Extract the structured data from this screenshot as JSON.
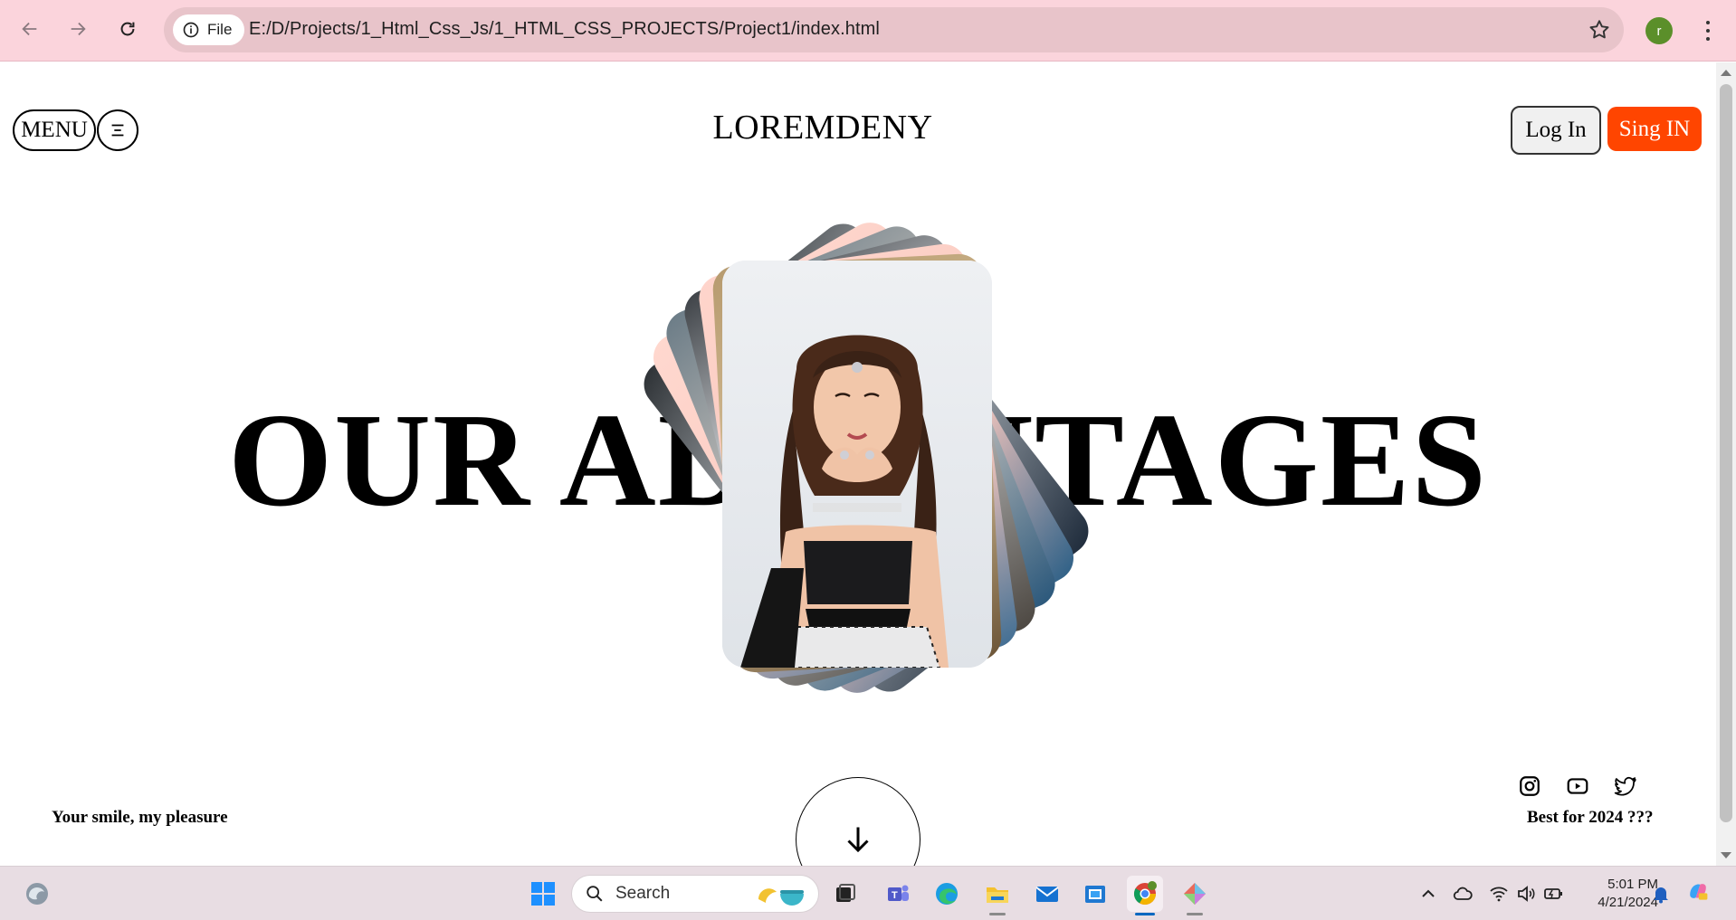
{
  "browser": {
    "site_label": "File",
    "url": "E:/D/Projects/1_Html_Css_Js/1_HTML_CSS_PROJECTS/Project1/index.html",
    "profile_initial": "r"
  },
  "page": {
    "menu_label": "MENU",
    "logo": "LOREMDENY",
    "login_label": "Log In",
    "signin_label": "Sing IN",
    "hero_title": "OUR ADVANTAGES",
    "tagline": "Your smile, my pleasure",
    "best_for": "Best for 2024 ???",
    "accent_color": "#ff4500",
    "social_icons": [
      "instagram-icon",
      "youtube-icon",
      "twitter-icon"
    ]
  },
  "taskbar": {
    "search_placeholder": "Search",
    "time": "5:01 PM",
    "date": "4/21/2024"
  }
}
